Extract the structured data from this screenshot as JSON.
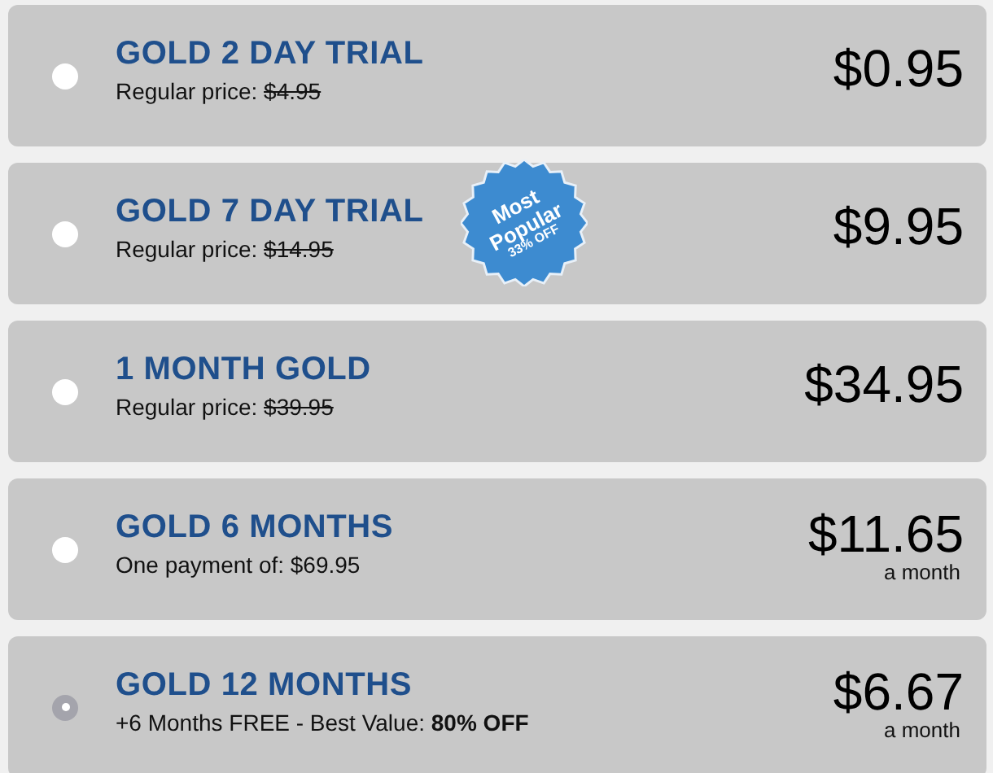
{
  "plans": [
    {
      "title": "GOLD 2 DAY TRIAL",
      "note": "Regular price:",
      "old_price": "$4.95",
      "price": "$0.95",
      "selected": false
    },
    {
      "title": "GOLD 7 DAY TRIAL",
      "note": "Regular price:",
      "old_price": "$14.95",
      "price": "$9.95",
      "selected": false,
      "badge": {
        "lines": [
          "Most",
          "Popular"
        ],
        "sub": "33% OFF"
      }
    },
    {
      "title": "1 MONTH GOLD",
      "note": "Regular price:",
      "old_price": "$39.95",
      "price": "$34.95",
      "selected": false
    },
    {
      "title": "GOLD 6 MONTHS",
      "note": "One payment of: $69.95",
      "price": "$11.65",
      "period": "a month",
      "selected": false
    },
    {
      "title": "GOLD 12 MONTHS",
      "note": "+6 Months FREE - Best Value: **80% OFF**",
      "price": "$6.67",
      "period": "a month",
      "selected": true
    }
  ]
}
